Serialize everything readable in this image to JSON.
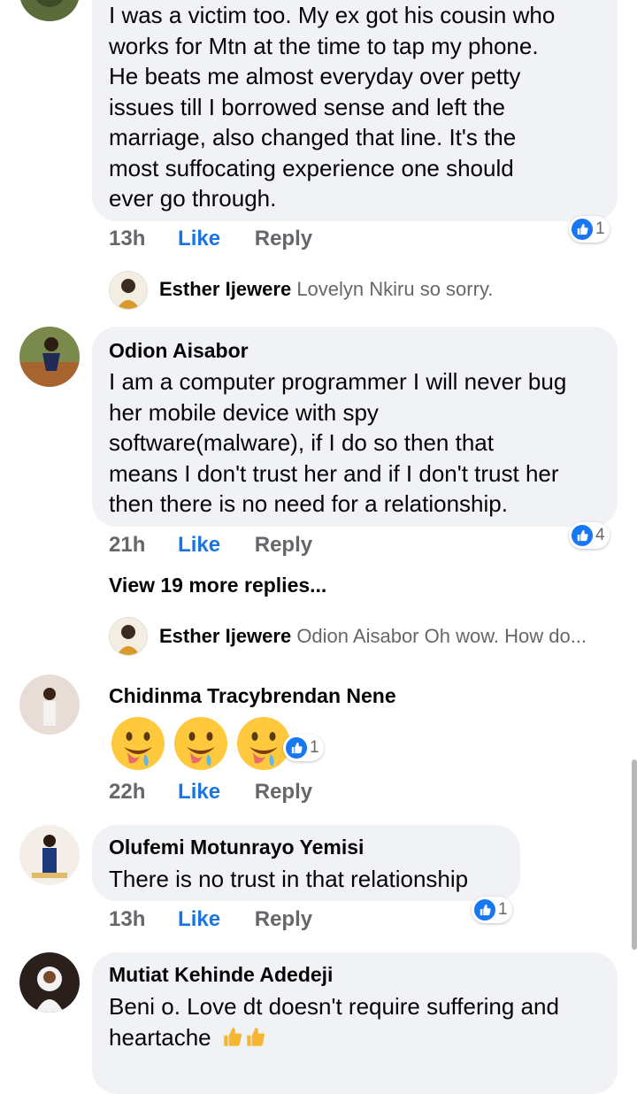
{
  "comments": [
    {
      "name": "",
      "lines": [
        "I was a victim too. My ex got his cousin who",
        "works for Mtn at the time to tap my phone.",
        "He beats me almost everyday over petty",
        "issues till I borrowed sense and left the",
        "marriage, also changed that line. It's the",
        "most suffocating experience one should",
        "ever go through."
      ],
      "time": "13h",
      "like": "Like",
      "reply": "Reply",
      "reactions": "1"
    },
    {
      "name": "Odion Aisabor",
      "lines": [
        "I am a computer programmer I will never bug",
        "her mobile device with spy",
        "software(malware), if I do so then that",
        "means I don't trust her and if I don't trust her",
        "then there is no need for a relationship."
      ],
      "time": "21h",
      "like": "Like",
      "reply": "Reply",
      "reactions": "4"
    },
    {
      "name": "Chidinma Tracybrendan Nene",
      "time": "22h",
      "like": "Like",
      "reply": "Reply",
      "reactions": "1",
      "emojis": [
        "drooling-face",
        "drooling-face",
        "drooling-face"
      ]
    },
    {
      "name": "Olufemi Motunrayo Yemisi",
      "lines": [
        "There is no trust in that relationship"
      ],
      "time": "13h",
      "like": "Like",
      "reply": "Reply",
      "reactions": "1"
    },
    {
      "name": "Mutiat Kehinde Adedeji",
      "lines": [
        "Beni o. Love dt doesn't require suffering and",
        "heartache"
      ]
    }
  ],
  "replies": [
    {
      "name": "Esther Ijewere",
      "text": "Lovelyn Nkiru so sorry."
    },
    {
      "name": "Esther Ijewere",
      "text": "Odion Aisabor Oh wow. How do..."
    }
  ],
  "view_more": "View 19 more replies...",
  "colors": {
    "accent": "#1877f2",
    "bubble": "#f0f2f5",
    "meta": "#65676b"
  },
  "icons": [
    "like-reaction-icon",
    "thumbs-up-emoji",
    "drooling-face-emoji"
  ]
}
